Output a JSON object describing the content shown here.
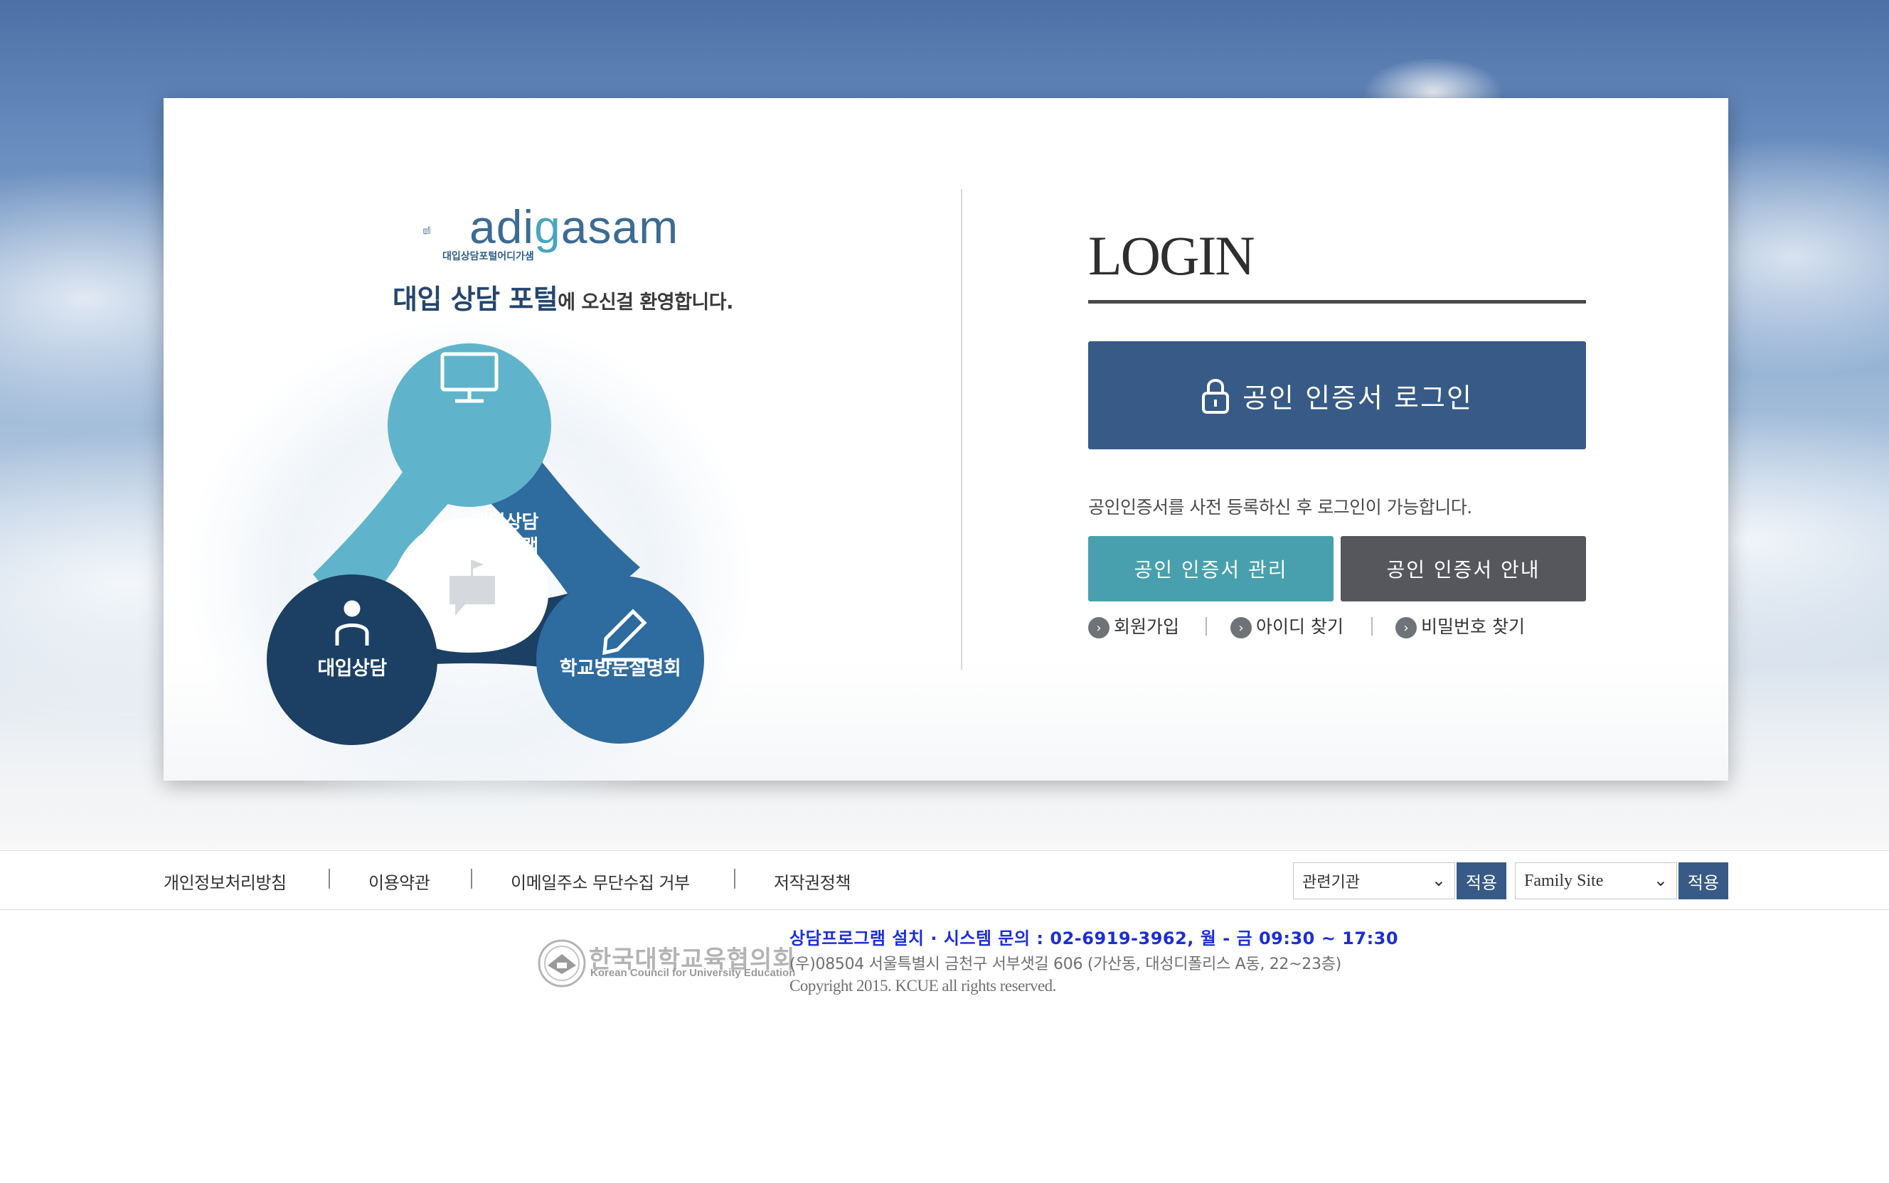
{
  "brand": {
    "logo_text_a": "adi",
    "logo_text_g": "g",
    "logo_text_b": "asam",
    "logo_subtitle": "대입상담포털어디가샘",
    "welcome_emphasis": "대입 상담 포털",
    "welcome_rest": "에 오신걸 환영합니다."
  },
  "diagram": {
    "top_label_line1": "대입상담",
    "top_label_line2": "프로그램",
    "left_label": "대입상담",
    "right_label": "학교방문설명회",
    "colors": {
      "top": "#5fb4cc",
      "left": "#1c3f64",
      "right": "#2e6b9f"
    }
  },
  "login": {
    "title": "LOGIN",
    "cert_login_label": "공인 인증서 로그인",
    "notice": "공인인증서를 사전 등록하신 후 로그인이 가능합니다.",
    "cert_manage_label": "공인 인증서 관리",
    "cert_guide_label": "공인 인증서 안내",
    "links": [
      {
        "label": "회원가입"
      },
      {
        "label": "아이디 찾기"
      },
      {
        "label": "비밀번호 찾기"
      }
    ],
    "colors": {
      "primary": "#375a87",
      "teal": "#48a0ae",
      "gray": "#55575c"
    }
  },
  "footer": {
    "links": [
      {
        "label": "개인정보처리방침"
      },
      {
        "label": "이용약관"
      },
      {
        "label": "이메일주소 무단수집 거부"
      },
      {
        "label": "저작권정책"
      }
    ],
    "related_select": "관련기관",
    "family_select": "Family Site",
    "apply_label": "적용",
    "org_name": "한국대학교육협의회",
    "org_name_en": "Korean Council for University Education",
    "contact": "상담프로그램 설치 · 시스템 문의 : 02-6919-3962, 월 - 금 09:30 ~ 17:30",
    "address": "(우)08504 서울특별시 금천구 서부샛길 606 (가산동, 대성디폴리스 A동, 22~23층)",
    "copyright": "Copyright 2015. KCUE all rights reserved."
  }
}
